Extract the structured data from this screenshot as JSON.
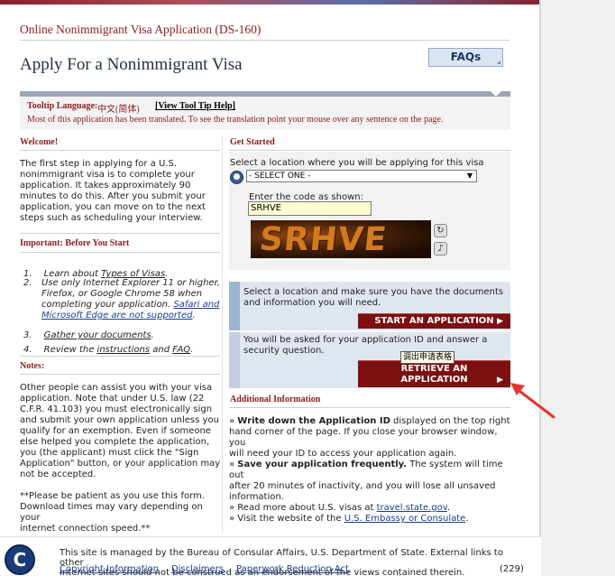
{
  "header": {
    "app_title": "Online Nonimmigrant Visa Application (DS-160)",
    "faqs_label": "FAQs",
    "page_title": "Apply For a Nonimmigrant Visa"
  },
  "language_bar": {
    "label": "Tooltip Language:",
    "value": "中文(简体)",
    "link": "[View Tool Tip Help]",
    "message": "Most of this application has been translated. To see the translation point your mouse over any sentence on the page."
  },
  "welcome": {
    "heading": "Welcome!",
    "lines": [
      "The first step in applying for a U.S.",
      "nonimmigrant visa is to complete your",
      "application. It takes approximately 90",
      "minutes to do this. After you submit your",
      "application, you can move on to the next",
      "steps such as scheduling your interview."
    ]
  },
  "important": {
    "heading": "Important: Before You Start",
    "items": [
      {
        "num": "1.",
        "lines": [
          "Learn about ",
          "Types of Visas",
          "."
        ]
      },
      {
        "num": "2.",
        "lines": [
          "Use only Internet Explorer 11 or higher,",
          "Firefox, or Google Chrome 58 when",
          "completing your application. ",
          "Safari and",
          "Microsoft Edge are not supported",
          "."
        ]
      },
      {
        "num": "3.",
        "lines": [
          "Gather your documents",
          "."
        ]
      },
      {
        "num": "4.",
        "lines": [
          "Review the ",
          "instructions",
          " and ",
          "FAQ",
          "."
        ]
      }
    ]
  },
  "notes": {
    "heading": "Notes:",
    "lines": [
      "Other people can assist you with your visa",
      "application. Note that under U.S. law (22",
      "C.F.R. 41.103) you must electronically sign",
      "and submit your own application unless you",
      "qualify for an exemption. Even if someone",
      "else helped you complete the application,",
      "you (the applicant) must click the \"Sign",
      "Application\" button, or your application may",
      "not be accepted."
    ],
    "patience_lines": [
      "**Please be patient as you use this form.",
      "Download times may vary depending on your",
      "internet connection speed.**"
    ]
  },
  "get_started": {
    "heading": "Get Started",
    "location_prompt": "Select a location where you will be applying for this visa",
    "location_select": "- SELECT ONE -",
    "code_label": "Enter the code as shown:",
    "code_value": "SRHVE",
    "captcha_text": "SRHVE",
    "refresh_icon": "refresh-icon",
    "audio_icon": "audio-icon"
  },
  "start_panel": {
    "text_1": "Select a location and make sure you have the documents",
    "text_2": "and information you will need.",
    "button": "START AN APPLICATION"
  },
  "retrieve_panel": {
    "text_1": "You will be asked for your application ID and answer a",
    "text_2": "security question.",
    "button_1": "RETRIEVE AN",
    "button_2": "APPLICATION",
    "tooltip": "调出申请表格"
  },
  "additional_info": {
    "heading": "Additional Information",
    "bullets": [
      {
        "bold": "Write down the Application ID",
        "rest": " displayed on the top right"
      },
      {
        "plain": "hand corner of the page. If you close your browser window, you"
      },
      {
        "plain": "will need your ID to access your application again."
      },
      {
        "bold": "Save your application frequently.",
        "rest": " The system will time out"
      },
      {
        "plain": "after 20 minutes of inactivity, and you will lose all unsaved"
      },
      {
        "plain": "information."
      },
      {
        "prefix": "Read more about U.S. visas at ",
        "link": "travel.state.gov",
        "suffix": "."
      },
      {
        "prefix": "Visit the website of the ",
        "link": "U.S. Embassy or Consulate",
        "suffix": "."
      }
    ]
  },
  "footer": {
    "line_1": "This site is managed by the Bureau of Consular Affairs, U.S. Department of State. External links to other",
    "line_2": "Internet sites should not be construed as an endorsement of the views contained therein.",
    "links": [
      "Copyright Information",
      "Disclaimers",
      "Paperwork Reduction Act"
    ],
    "page_code": "(229)",
    "seal_letter": "C"
  },
  "colors": {
    "accent_red": "#8b1a1a",
    "button_red": "#7d1010",
    "panel_blue": "#dfe6f0",
    "link_blue": "#1a3e8c"
  }
}
